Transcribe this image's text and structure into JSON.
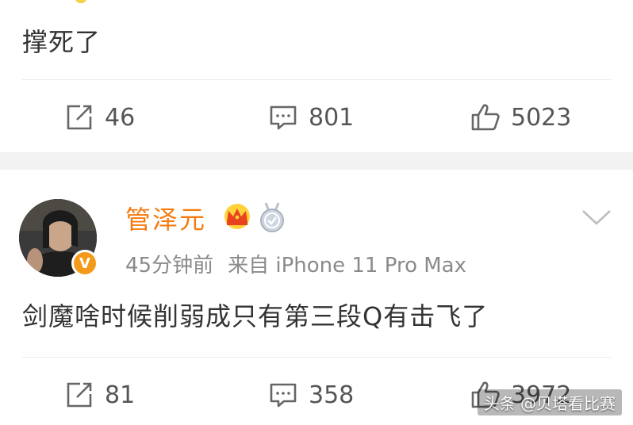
{
  "post_top": {
    "text": "撑死了",
    "actions": {
      "repost_count": "46",
      "comment_count": "801",
      "like_count": "5023"
    }
  },
  "post_main": {
    "username": "管泽元",
    "avatar_badge": "V",
    "time": "45分钟前",
    "source": "来自 iPhone 11 Pro Max",
    "text": "剑魔啥时候削弱成只有第三段Q有击飞了",
    "actions": {
      "repost_count": "81",
      "comment_count": "358",
      "like_count": "3972"
    }
  },
  "watermark": "头条 @贝塔看比赛",
  "colors": {
    "username": "#f57b0f",
    "verified_badge": "#f39a1b",
    "separator": "#f2f2f2",
    "meta_text": "#8a8a8a"
  },
  "icons": [
    "repost-icon",
    "comment-icon",
    "like-icon",
    "crown-badge-icon",
    "medal-badge-icon",
    "chevron-down-icon",
    "verified-badge-icon"
  ]
}
